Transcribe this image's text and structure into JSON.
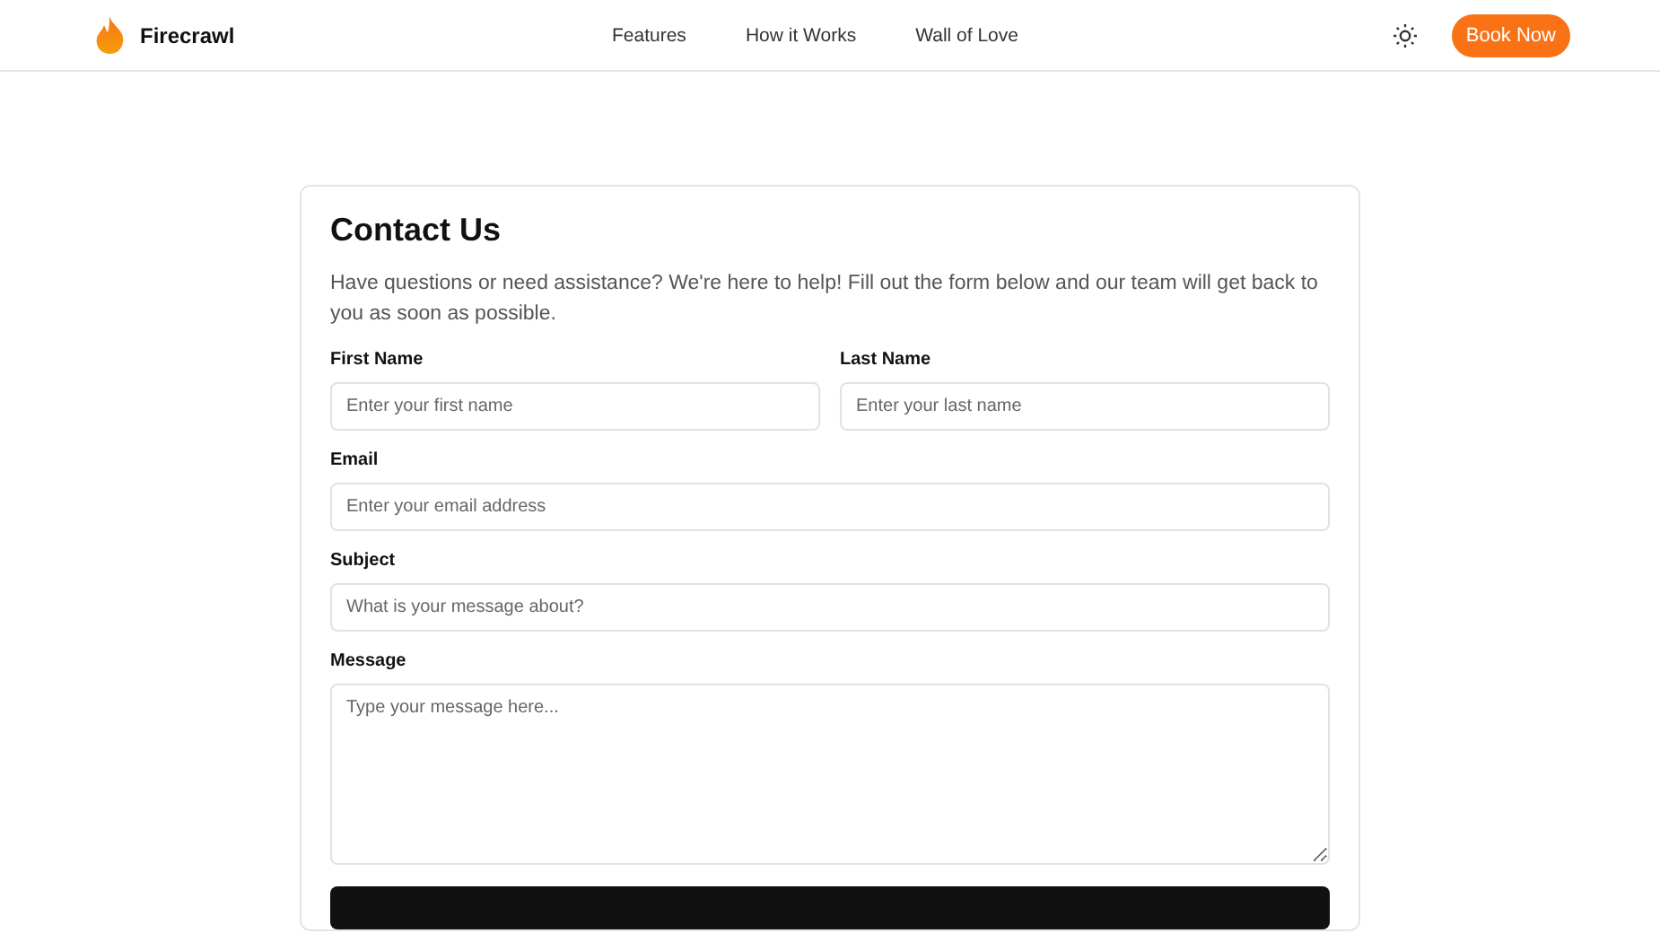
{
  "header": {
    "brand": "Firecrawl",
    "nav": [
      {
        "label": "Features"
      },
      {
        "label": "How it Works"
      },
      {
        "label": "Wall of Love"
      }
    ],
    "cta": "Book Now"
  },
  "form": {
    "title": "Contact Us",
    "intro": "Have questions or need assistance? We're here to help! Fill out the form below and our team will get back to you as soon as possible.",
    "name_fields": [
      {
        "label": "First Name",
        "placeholder": "Enter your first name"
      },
      {
        "label": "Last Name",
        "placeholder": "Enter your last name"
      }
    ],
    "fields": [
      {
        "label": "Email",
        "placeholder": "Enter your email address"
      },
      {
        "label": "Subject",
        "placeholder": "What is your message about?"
      }
    ],
    "message": {
      "label": "Message",
      "placeholder": "Type your message here..."
    }
  }
}
